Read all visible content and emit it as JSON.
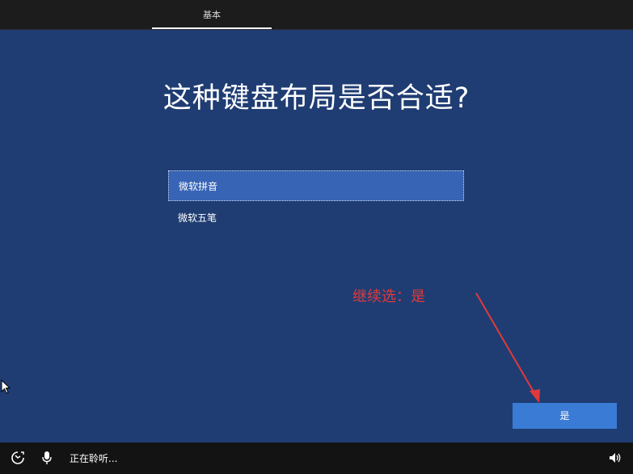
{
  "top_tab": {
    "label": "基本"
  },
  "main": {
    "title": "这种键盘布局是否合适?",
    "layouts": [
      {
        "label": "微软拼音",
        "selected": true
      },
      {
        "label": "微软五笔",
        "selected": false
      }
    ],
    "annotation": "继续选：是",
    "annotation_color": "#e03a3a",
    "yes_button": "是"
  },
  "bottom_bar": {
    "status": "正在聆听...",
    "icons": [
      "accessibility-icon",
      "microphone-icon",
      "volume-icon"
    ]
  },
  "colors": {
    "background": "#1f3d73",
    "selected_item": "#3764b4",
    "button": "#3a7bd5"
  }
}
